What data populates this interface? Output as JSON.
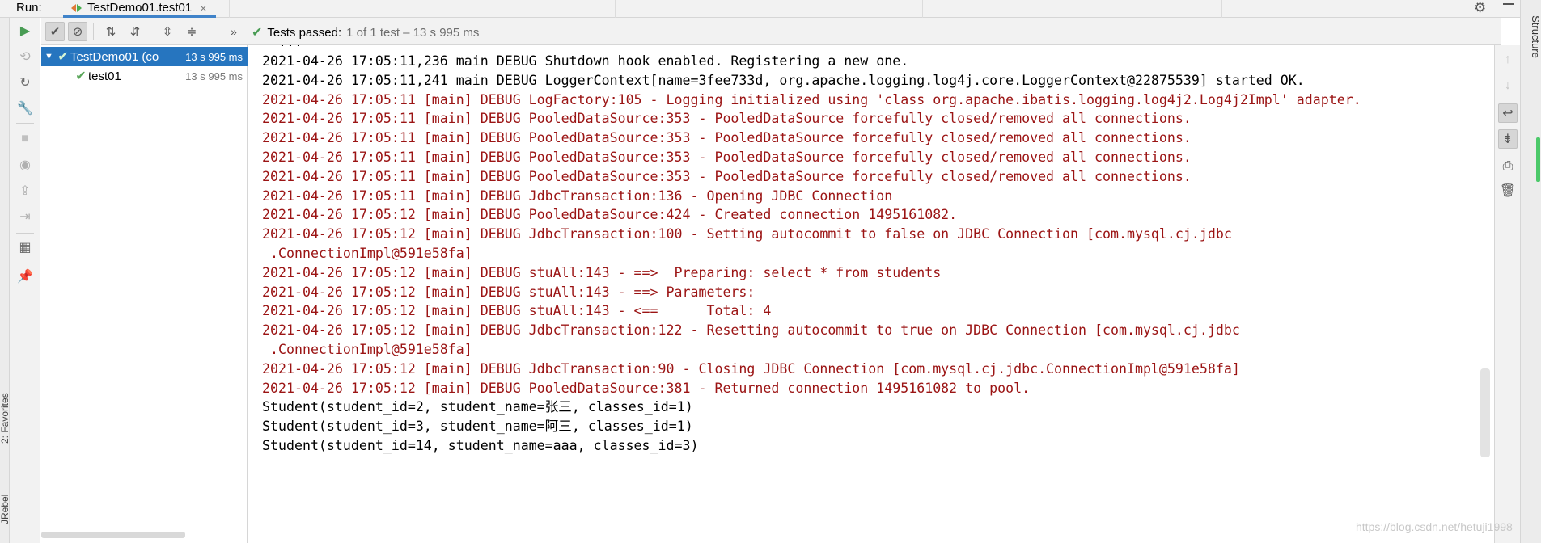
{
  "window": {
    "run_label": "Run:",
    "tab_title": "TestDemo01.test01",
    "tab_close": "×"
  },
  "test_toolbar": {
    "status_passed": "Tests passed:",
    "status_counts": "1 of 1 test – 13 s 995 ms",
    "more_label": "»"
  },
  "tree": {
    "root_name": "TestDemo01 (co",
    "root_time": "13 s 995 ms",
    "child_name": "test01",
    "child_time": "13 s 995 ms"
  },
  "side_labels": {
    "favorites": "2: Favorites",
    "jrebel": "JRebel",
    "structure": "Structure"
  },
  "console": {
    "partial_top": "  ...",
    "lines": [
      {
        "type": "info",
        "text": "2021-04-26 17:05:11,236 main DEBUG Shutdown hook enabled. Registering a new one."
      },
      {
        "type": "info",
        "text": "2021-04-26 17:05:11,241 main DEBUG LoggerContext[name=3fee733d, org.apache.logging.log4j.core.LoggerContext@22875539] started OK."
      },
      {
        "type": "debug",
        "text": "2021-04-26 17:05:11 [main] DEBUG LogFactory:105 - Logging initialized using 'class org.apache.ibatis.logging.log4j2.Log4j2Impl' adapter."
      },
      {
        "type": "debug",
        "text": "2021-04-26 17:05:11 [main] DEBUG PooledDataSource:353 - PooledDataSource forcefully closed/removed all connections."
      },
      {
        "type": "debug",
        "text": "2021-04-26 17:05:11 [main] DEBUG PooledDataSource:353 - PooledDataSource forcefully closed/removed all connections."
      },
      {
        "type": "debug",
        "text": "2021-04-26 17:05:11 [main] DEBUG PooledDataSource:353 - PooledDataSource forcefully closed/removed all connections."
      },
      {
        "type": "debug",
        "text": "2021-04-26 17:05:11 [main] DEBUG PooledDataSource:353 - PooledDataSource forcefully closed/removed all connections."
      },
      {
        "type": "debug",
        "text": "2021-04-26 17:05:11 [main] DEBUG JdbcTransaction:136 - Opening JDBC Connection"
      },
      {
        "type": "debug",
        "text": "2021-04-26 17:05:12 [main] DEBUG PooledDataSource:424 - Created connection 1495161082."
      },
      {
        "type": "debug",
        "text": "2021-04-26 17:05:12 [main] DEBUG JdbcTransaction:100 - Setting autocommit to false on JDBC Connection [com.mysql.cj.jdbc"
      },
      {
        "type": "debug",
        "text": " .ConnectionImpl@591e58fa]"
      },
      {
        "type": "debug",
        "text": "2021-04-26 17:05:12 [main] DEBUG stuAll:143 - ==>  Preparing: select * from students"
      },
      {
        "type": "debug",
        "text": "2021-04-26 17:05:12 [main] DEBUG stuAll:143 - ==> Parameters: "
      },
      {
        "type": "debug",
        "text": "2021-04-26 17:05:12 [main] DEBUG stuAll:143 - <==      Total: 4"
      },
      {
        "type": "debug",
        "text": "2021-04-26 17:05:12 [main] DEBUG JdbcTransaction:122 - Resetting autocommit to true on JDBC Connection [com.mysql.cj.jdbc"
      },
      {
        "type": "debug",
        "text": " .ConnectionImpl@591e58fa]"
      },
      {
        "type": "debug",
        "text": "2021-04-26 17:05:12 [main] DEBUG JdbcTransaction:90 - Closing JDBC Connection [com.mysql.cj.jdbc.ConnectionImpl@591e58fa]"
      },
      {
        "type": "debug",
        "text": "2021-04-26 17:05:12 [main] DEBUG PooledDataSource:381 - Returned connection 1495161082 to pool."
      },
      {
        "type": "info",
        "text": "Student(student_id=2, student_name=张三, classes_id=1)"
      },
      {
        "type": "info",
        "text": "Student(student_id=3, student_name=阿三, classes_id=1)"
      },
      {
        "type": "info",
        "text": "Student(student_id=14, student_name=aaa, classes_id=3)"
      }
    ]
  },
  "watermark": "https://blog.csdn.net/hetuji1998",
  "colors": {
    "accent": "#2675bf",
    "pass_green": "#499c54",
    "debug_red": "#9b1414",
    "panel_bg": "#f2f2f2"
  },
  "icons": {
    "left_toolbar": [
      "run-icon",
      "rerun-failed-icon",
      "toggle-auto-test-icon",
      "wrench-icon",
      "stop-icon",
      "camera-icon",
      "export-icon",
      "import-icon",
      "layout-icon",
      "pin-icon"
    ],
    "test_toolbar": [
      "show-passed-icon",
      "show-ignored-icon",
      "sort-alpha-icon",
      "sort-duration-icon",
      "expand-all-icon",
      "collapse-all-icon"
    ],
    "right_toolbar": [
      "up-arrow-icon",
      "down-arrow-icon",
      "soft-wrap-icon",
      "scroll-to-end-icon",
      "print-icon",
      "trash-icon"
    ]
  }
}
